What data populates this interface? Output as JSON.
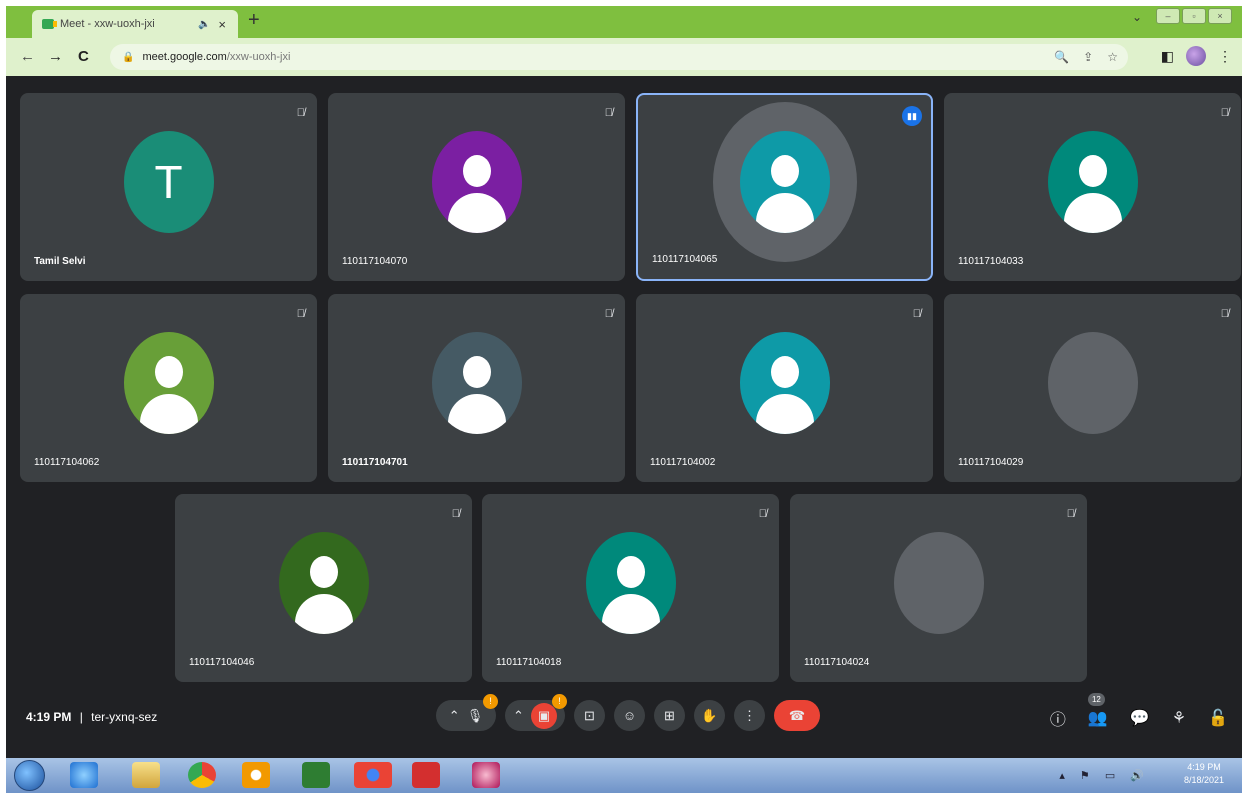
{
  "browser": {
    "tab_title": "Meet - xxw-uoxh-jxi",
    "tab_close": "×",
    "new_tab": "+",
    "url_host": "meet.google.com",
    "url_path": "/xxw-uoxh-jxi",
    "back": "←",
    "forward": "→",
    "reload": "C"
  },
  "participants": [
    {
      "name": "Tamil Selvi",
      "initial": "T",
      "color": "#1a8d77"
    },
    {
      "name": "110117104070",
      "color": "#7b1fa2"
    },
    {
      "name": "110117104065",
      "color": "#0e9aa7",
      "speaking": true
    },
    {
      "name": "110117104033",
      "color": "#00897b"
    },
    {
      "name": "110117104062",
      "color": "#689f38"
    },
    {
      "name": "110117104701",
      "color": "#455a64"
    },
    {
      "name": "110117104002",
      "color": "#0e9aa7"
    },
    {
      "name": "110117104029",
      "color": "#5f6368"
    },
    {
      "name": "110117104046",
      "color": "#33691e"
    },
    {
      "name": "110117104018",
      "color": "#00897b"
    },
    {
      "name": "110117104024",
      "color": "#5f6368"
    }
  ],
  "meeting": {
    "time": "4:19 PM",
    "separator": "|",
    "code": "ter-yxnq-sez",
    "people_count": "12"
  },
  "icons": {
    "mic_off": "mic-off-icon",
    "speaking": "audio-wave-icon",
    "captions": "captions-icon",
    "emoji": "emoji-icon",
    "present": "present-icon",
    "hand": "raise-hand-icon",
    "more": "more-vert-icon",
    "end": "call-end-icon",
    "info": "info-icon",
    "people": "people-icon",
    "chat": "chat-icon",
    "activities": "activities-icon",
    "lock": "host-controls-icon"
  },
  "taskbar": {
    "clock_time": "4:19 PM",
    "clock_date": "8/18/2021"
  }
}
